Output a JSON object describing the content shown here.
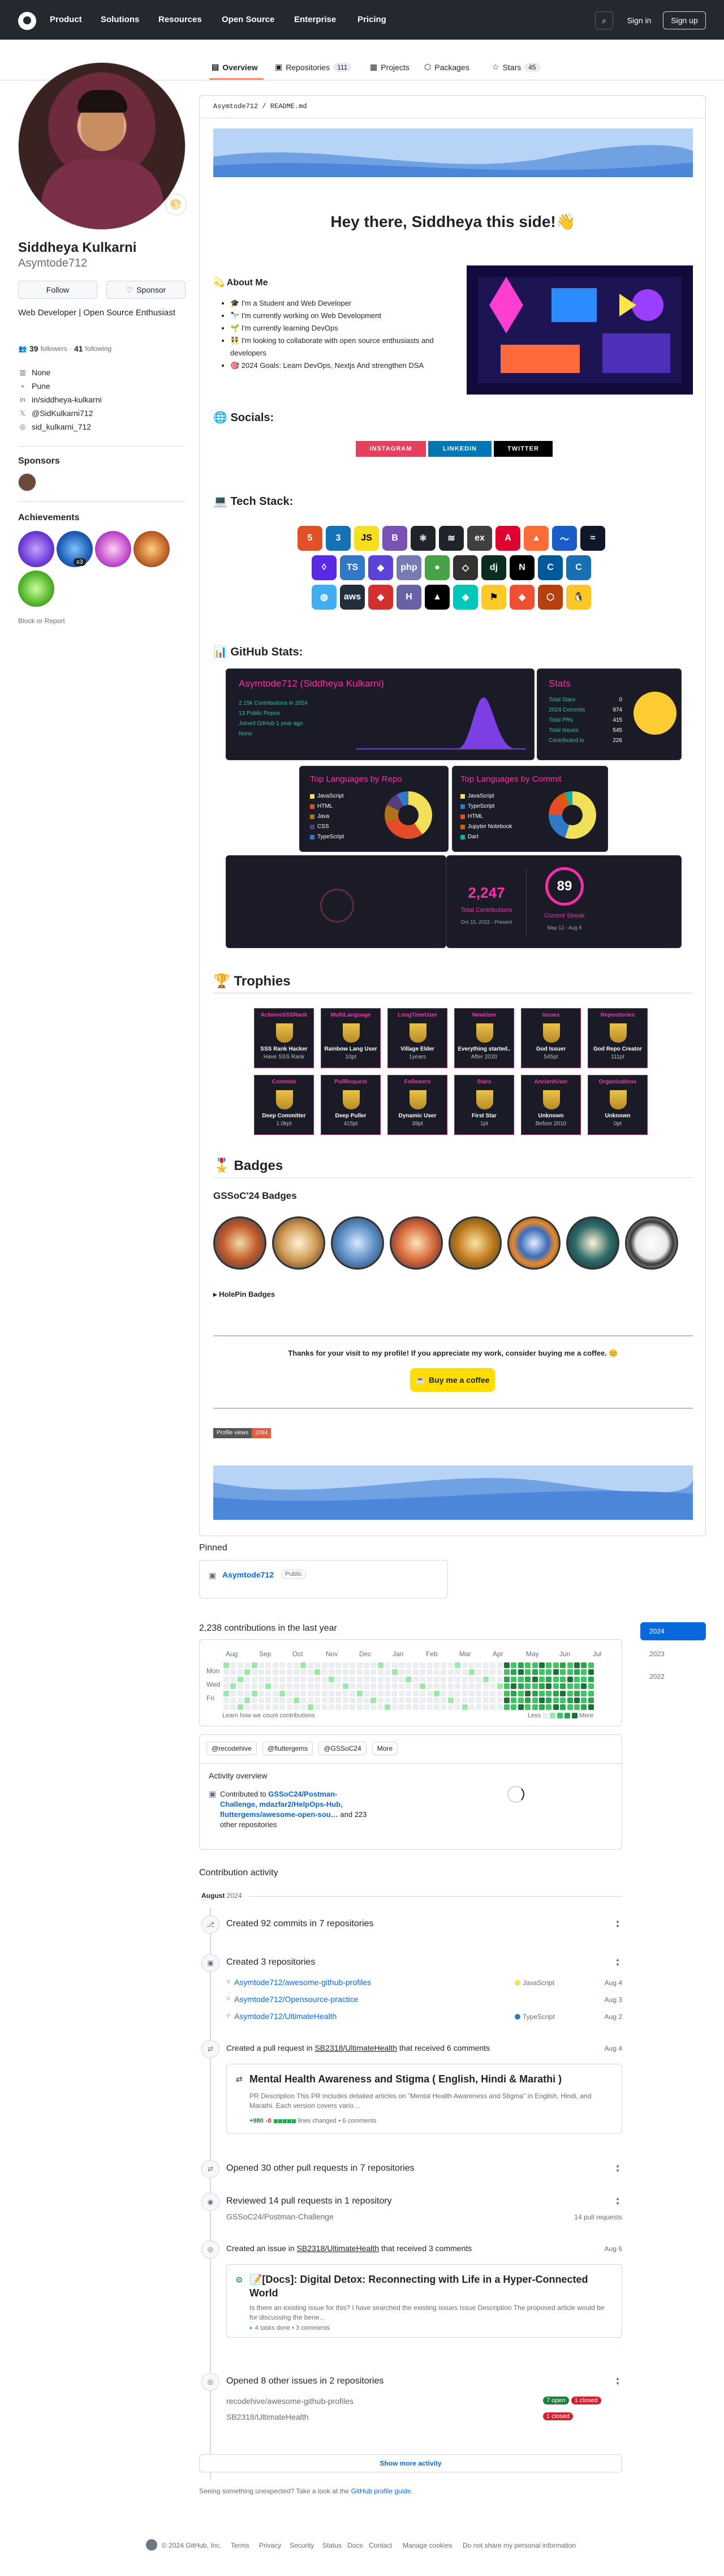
{
  "header": {
    "nav": [
      "Product",
      "Solutions",
      "Resources",
      "Open Source",
      "Enterprise",
      "Pricing"
    ],
    "sign_in": "Sign in",
    "sign_up": "Sign up"
  },
  "tabs": {
    "overview": "Overview",
    "repositories": "Repositories",
    "repositories_count": "111",
    "projects": "Projects",
    "packages": "Packages",
    "stars": "Stars",
    "stars_count": "45"
  },
  "profile": {
    "name": "Siddheya Kulkarni",
    "username": "Asymtode712",
    "follow": "Follow",
    "sponsor": "Sponsor",
    "bio": "Web Developer | Open Source Enthusiast",
    "followers": "39",
    "followers_label": "followers",
    "following": "41",
    "following_label": "following",
    "company": "None",
    "location": "Pune",
    "linkedin": "in/siddheya-kulkarni",
    "twitter": "@SidKulkarni712",
    "instagram": "sid_kulkarni_712",
    "sponsors_title": "Sponsors",
    "achievements_title": "Achievements",
    "ach_count": "x3",
    "block": "Block or Report"
  },
  "readme": {
    "path": "Asymtode712 / README.md",
    "greeting": "Hey there, Siddheya this side!👋",
    "about_title": "💫 About Me",
    "about": [
      "🎓 I'm a Student and Web Developer",
      "🔭 I'm currently working on Web Development",
      "🌱 I'm currently learning DevOps",
      "👯 I'm looking to collaborate with open source enthusiasts and developers",
      "🎯 2024 Goals: Learn DevOps, Nextjs And strengthen DSA"
    ],
    "socials_title": "🌐 Socials:",
    "socials": [
      "INSTAGRAM",
      "LINKEDIN",
      "TWITTER"
    ],
    "tech_title": "💻 Tech Stack:",
    "tech": [
      {
        "t": "5",
        "c": "#e34f26"
      },
      {
        "t": "3",
        "c": "#1572b6"
      },
      {
        "t": "JS",
        "c": "#f7df1e"
      },
      {
        "t": "B",
        "c": "#7952b3"
      },
      {
        "t": "⚛",
        "c": "#20232a"
      },
      {
        "t": "≋",
        "c": "#20232a"
      },
      {
        "t": "ex",
        "c": "#404040"
      },
      {
        "t": "A",
        "c": "#dd0031"
      },
      {
        "t": "▲",
        "c": "#ff6c37"
      },
      {
        "t": "〜",
        "c": "#1a5cc8"
      },
      {
        "t": "≈",
        "c": "#0f172a"
      },
      {
        "t": "◊",
        "c": "#5a29e4"
      },
      {
        "t": "TS",
        "c": "#3178c6"
      },
      {
        "t": "◆",
        "c": "#5a43d6"
      },
      {
        "t": "php",
        "c": "#777bb4"
      },
      {
        "t": "●",
        "c": "#47a248"
      },
      {
        "t": "◇",
        "c": "#323330"
      },
      {
        "t": "dj",
        "c": "#092e20"
      },
      {
        "t": "N",
        "c": "#000000"
      },
      {
        "t": "C",
        "c": "#00599c"
      },
      {
        "t": "C",
        "c": "#1a6fb3"
      },
      {
        "t": "◍",
        "c": "#40aef0"
      },
      {
        "t": "aws",
        "c": "#232f3e"
      },
      {
        "t": "◆",
        "c": "#d32f2f"
      },
      {
        "t": "H",
        "c": "#6762a6"
      },
      {
        "t": "▲",
        "c": "#000000"
      },
      {
        "t": "◈",
        "c": "#00c7b7"
      },
      {
        "t": "⚑",
        "c": "#ffca28"
      },
      {
        "t": "◆",
        "c": "#f05032"
      },
      {
        "t": "⬡",
        "c": "#b7410e"
      },
      {
        "t": "🐧",
        "c": "#fcc624"
      }
    ],
    "stats_title": "📊 GitHub Stats:",
    "stats_card_title": "Asymtode712 (Siddheya Kulkarni)",
    "stats_lines": [
      "2.15k Contributions in 2024",
      "13 Public Repos",
      "Joined GitHub 1 year ago",
      "None"
    ],
    "stats_right_title": "Stats",
    "stats_right": [
      [
        "Total Stars",
        "0"
      ],
      [
        "2024 Commits",
        "974"
      ],
      [
        "Total PRs",
        "415"
      ],
      [
        "Total Issues",
        "545"
      ],
      [
        "Contributed to",
        "226"
      ]
    ],
    "lang_repo_title": "Top Languages by Repo",
    "lang_repo": [
      "JavaScript",
      "HTML",
      "Java",
      "CSS",
      "TypeScript"
    ],
    "lang_commit_title": "Top Languages by Commit",
    "lang_commit": [
      "JavaScript",
      "TypeScript",
      "HTML",
      "Jupyter Notebook",
      "Dart"
    ],
    "streak_total": "2,247",
    "streak_total_label": "Total Contributions",
    "streak_total_range": "Oct 15, 2022 - Present",
    "streak_current": "89",
    "streak_current_label": "Current Streak",
    "streak_current_range": "May 12 - Aug 8",
    "trophies_title": "🏆 Trophies",
    "trophies": [
      {
        "t": "AchieveSSSRank",
        "r": "SSS Rank Hacker",
        "s": "Have SSS Rank"
      },
      {
        "t": "MultiLanguage",
        "r": "Rainbow Lang User",
        "s": "10pt"
      },
      {
        "t": "LongTimeUser",
        "r": "Village Elder",
        "s": "1years"
      },
      {
        "t": "NewUser",
        "r": "Everything started..",
        "s": "After 2020"
      },
      {
        "t": "Issues",
        "r": "God Issuer",
        "s": "545pt"
      },
      {
        "t": "Repositories",
        "r": "God Repo Creator",
        "s": "111pt"
      },
      {
        "t": "Commits",
        "r": "Deep Committer",
        "s": "1.0kpt"
      },
      {
        "t": "PullRequest",
        "r": "Deep Puller",
        "s": "415pt"
      },
      {
        "t": "Followers",
        "r": "Dynamic User",
        "s": "39pt"
      },
      {
        "t": "Stars",
        "r": "First Star",
        "s": "1pt"
      },
      {
        "t": "AncientUser",
        "r": "Unknown",
        "s": "Before 2010"
      },
      {
        "t": "Organizations",
        "r": "Unknown",
        "s": "0pt"
      }
    ],
    "badges_title": "🎖️ Badges",
    "gssoc_title": "GSSoC'24 Badges",
    "holopin": "HolePin Badges",
    "thanks": "Thanks for your visit to my profile! If you appreciate my work, consider buying me a coffee. 😊",
    "coffee": "Buy me a coffee",
    "views_label": "Profile views",
    "views": "2084"
  },
  "pinned": {
    "title": "Pinned",
    "repo": "Asymtode712",
    "visibility": "Public"
  },
  "contrib": {
    "title": "2,238 contributions in the last year",
    "months": [
      "Aug",
      "Sep",
      "Oct",
      "Nov",
      "Dec",
      "Jan",
      "Feb",
      "Mar",
      "Apr",
      "May",
      "Jun",
      "Jul"
    ],
    "days": [
      "Mon",
      "Wed",
      "Fri"
    ],
    "learn": "Learn how we count contributions",
    "less": "Less",
    "more": "More",
    "years": [
      "2024",
      "2023",
      "2022"
    ],
    "orgs": [
      "@recodehive",
      "@fluttergems",
      "@GSSoC24"
    ],
    "orgs_more": "More",
    "activity_title": "Activity overview",
    "contributed_prefix": "Contributed to",
    "contributed_repos": "GSSoC24/Postman-Challenge, mdazfar2/HelpOps-Hub, fluttergems/awesome-open-sou…",
    "contributed_suffix": "and 223 other repositories"
  },
  "activity": {
    "title": "Contribution activity",
    "month": "August",
    "year": "2024",
    "commits": "Created 92 commits in 7 repositories",
    "repos_created": "Created 3 repositories",
    "repos": [
      {
        "n": "Asymtode712/awesome-github-profiles",
        "l": "JavaScript",
        "d": "Aug 4",
        "c": "#f1e05a"
      },
      {
        "n": "Asymtode712/Opensource-practice",
        "l": "",
        "d": "Aug 3",
        "c": ""
      },
      {
        "n": "Asymtode712/UltimateHealth",
        "l": "TypeScript",
        "d": "Aug 2",
        "c": "#3178c6"
      }
    ],
    "pr_prefix": "Created a pull request in",
    "pr_repo": "SB2318/UltimateHealth",
    "pr_suffix": "that received 6 comments",
    "pr_date": "Aug 4",
    "pr_title": "Mental Health Awareness and Stigma ( English, Hindi & Marathi )",
    "pr_body": "PR Description This PR includes detailed articles on \"Mental Health Awareness and Stigma\" in English, Hindi, and Marathi. Each version covers vario…",
    "pr_add": "+980",
    "pr_del": "-0",
    "pr_lines": "lines changed",
    "pr_comments": "• 6 comments",
    "opened_prs": "Opened 30 other pull requests in 7 repositories",
    "reviewed": "Reviewed 14 pull requests in 1 repository",
    "reviewed_repo": "GSSoC24/Postman-Challenge",
    "reviewed_count": "14 pull requests",
    "issue_prefix": "Created an issue in",
    "issue_repo": "SB2318/UltimateHealth",
    "issue_suffix": "that received 3 comments",
    "issue_date": "Aug 6",
    "issue_title": "📝[Docs]: Digital Detox: Reconnecting with Life in a Hyper-Connected World",
    "issue_body": "Is there an existing issue for this? I have searched the existing issues Issue Description The proposed article would be for discussing the bene…",
    "issue_meta": "4 tasks done • 3 comments",
    "other_issues": "Opened 8 other issues in 2 repositories",
    "issue_repos": [
      {
        "n": "recodehive/awesome-github-profiles",
        "o": "7",
        "oc": "open",
        "cl": "1",
        "cc": "closed"
      },
      {
        "n": "SB2318/UltimateHealth",
        "o": "",
        "oc": "",
        "cl": "1",
        "cc": "closed"
      }
    ],
    "show_more": "Show more activity",
    "unexpected": "Seeing something unexpected? Take a look at the",
    "guide": "GitHub profile guide"
  },
  "footer": [
    "© 2024 GitHub, Inc.",
    "Terms",
    "Privacy",
    "Security",
    "Status",
    "Docs",
    "Contact",
    "Manage cookies",
    "Do not share my personal information"
  ]
}
